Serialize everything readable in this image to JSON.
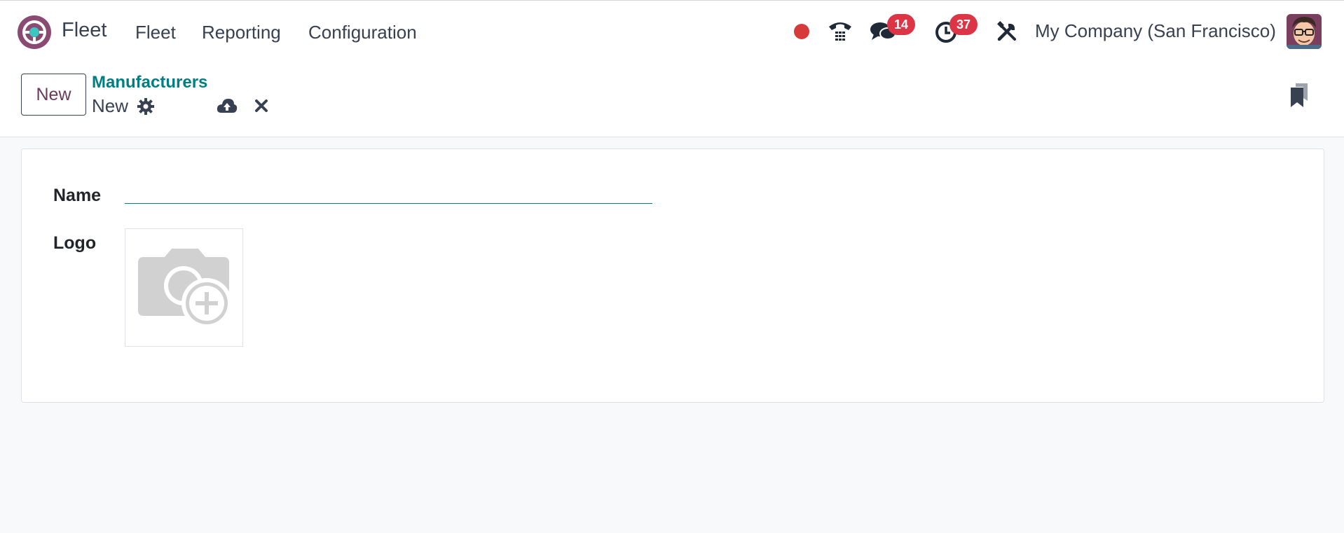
{
  "navbar": {
    "app_name": "Fleet",
    "menu": [
      "Fleet",
      "Reporting",
      "Configuration"
    ],
    "messages_count": "14",
    "activities_count": "37",
    "company": "My Company (San Francisco)",
    "icons": [
      "fleet-logo-icon",
      "status-dot-icon",
      "phone-icon",
      "chat-icon",
      "clock-icon",
      "tools-icon",
      "user-avatar"
    ]
  },
  "control_panel": {
    "new_button": "New",
    "breadcrumb_parent": "Manufacturers",
    "breadcrumb_current": "New",
    "icons": [
      "gear-icon",
      "cloud-upload-icon",
      "close-icon",
      "bookmark-icon"
    ]
  },
  "form": {
    "name_label": "Name",
    "name_value": "",
    "logo_label": "Logo"
  },
  "colors": {
    "brand": "#714b67",
    "accent": "#017e84",
    "badge": "#dc3545",
    "status_dot": "#d63a3a"
  }
}
